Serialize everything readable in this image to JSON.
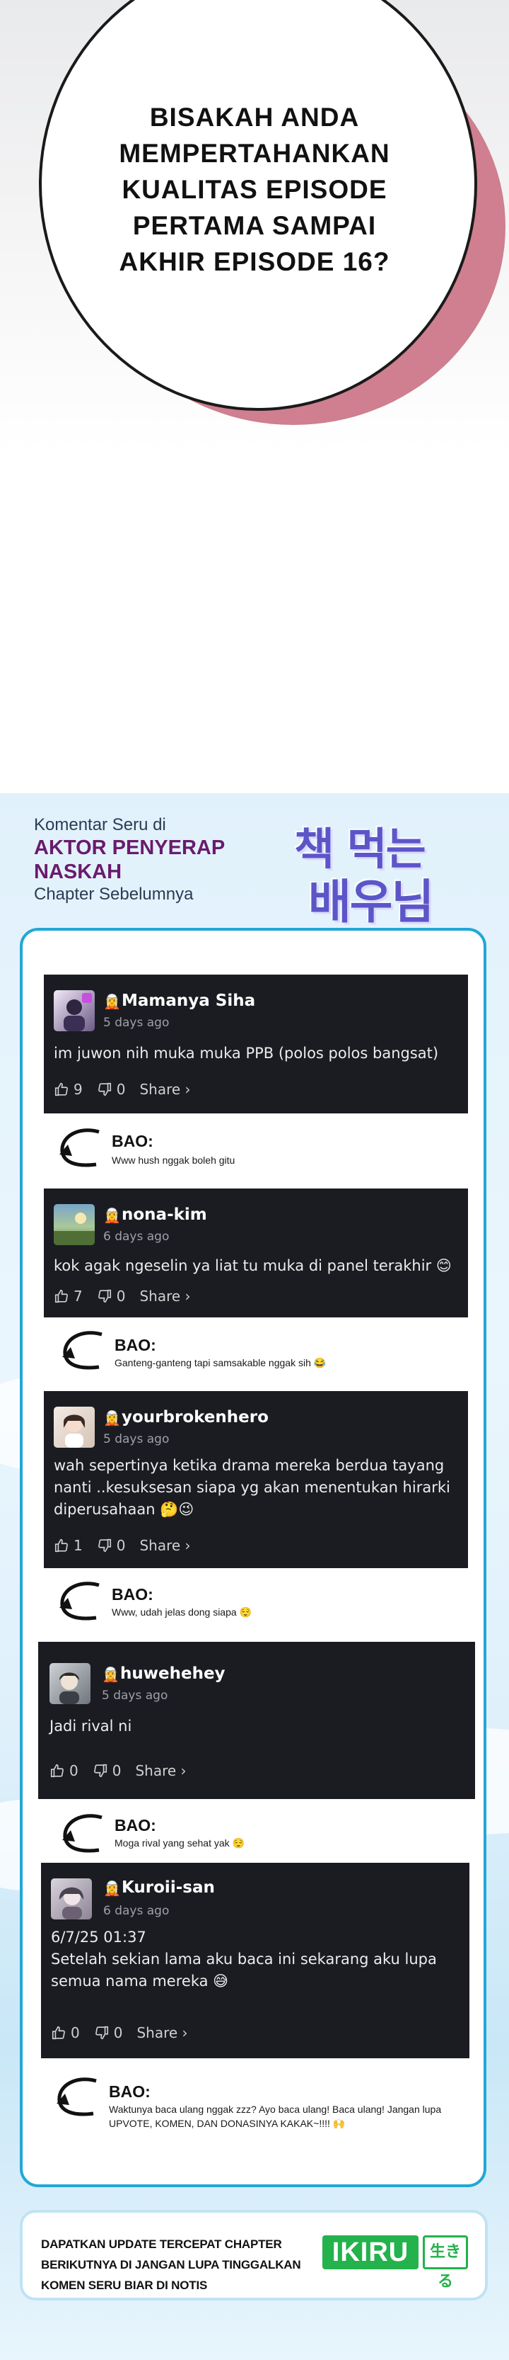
{
  "panel": {
    "bubble_lines": [
      "BISAKAH ANDA",
      "MEMPERTAHANKAN",
      "KUALITAS EPISODE",
      "PERTAMA SAMPAI",
      "AKHIR EPISODE 16?"
    ],
    "colors": {
      "bubble_shadow": "#cf7f8f",
      "outline": "#1a1a1a"
    }
  },
  "promo": {
    "line1": "Komentar Seru di",
    "title_line1": "AKTOR PENYERAP",
    "title_line2": "NASKAH",
    "line3": "Chapter Sebelumnya",
    "logo_line1": "책 먹는",
    "logo_line2": "배우님",
    "colors": {
      "title": "#6a1a6e",
      "logo": "#5b56c8",
      "card_border": "#22a7d6",
      "comment_bg": "#1b1c22"
    }
  },
  "comments": [
    {
      "user": "Mamanya Siha",
      "time": "5 days ago",
      "text": "im juwon nih muka muka PPB (polos polos bangsat)",
      "likes": "9",
      "dislikes": "0",
      "share": "Share ›",
      "badge_icon": "rank-badge-icon",
      "reply_name": "BAO:",
      "reply_text": "Www hush nggak boleh gitu"
    },
    {
      "user": "nona-kim",
      "time": "6 days ago",
      "text": "kok agak ngeselin ya liat tu muka di panel terakhir 😊",
      "likes": "7",
      "dislikes": "0",
      "share": "Share ›",
      "badge_icon": "rank-badge-icon",
      "reply_name": "BAO:",
      "reply_text": "Ganteng-ganteng tapi samsakable nggak sih 😂"
    },
    {
      "user": "yourbrokenhero",
      "time": "5 days ago",
      "text": "wah sepertinya ketika drama mereka berdua tayang nanti ..kesuksesan siapa yg akan menentukan hirarki diperusahaan 🤔😉",
      "likes": "1",
      "dislikes": "0",
      "share": "Share ›",
      "badge_icon": "rank-badge-icon",
      "reply_name": "BAO:",
      "reply_text": "Www, udah jelas dong siapa 😌"
    },
    {
      "user": "huwehehey",
      "time": "5 days ago",
      "text": "Jadi rival ni",
      "likes": "0",
      "dislikes": "0",
      "share": "Share ›",
      "badge_icon": "rank-badge-icon",
      "reply_name": "BAO:",
      "reply_text": "Moga rival yang sehat yak 😌"
    },
    {
      "user": "Kuroii-san",
      "time": "6 days ago",
      "text": "6/7/25 01:37\nSetelah sekian lama aku baca ini sekarang aku lupa semua nama mereka 😅",
      "likes": "0",
      "dislikes": "0",
      "share": "Share ›",
      "badge_icon": "rank-badge-icon",
      "reply_name": "BAO:",
      "reply_text": "Waktunya baca ulang nggak zzz? Ayo baca ulang! Baca ulang! Jangan lupa UPVOTE, KOMEN, DAN DONASINYA KAKAK~!!!! 🙌"
    }
  ],
  "footer": {
    "text": "DAPATKAN UPDATE TERCEPAT CHAPTER BERIKUTNYA DI JANGAN LUPA TINGGALKAN KOMEN SERU BIAR DI NOTIS",
    "logo_main": "IKIRU",
    "logo_side": "生きる",
    "colors": {
      "logo": "#23b24b"
    }
  }
}
